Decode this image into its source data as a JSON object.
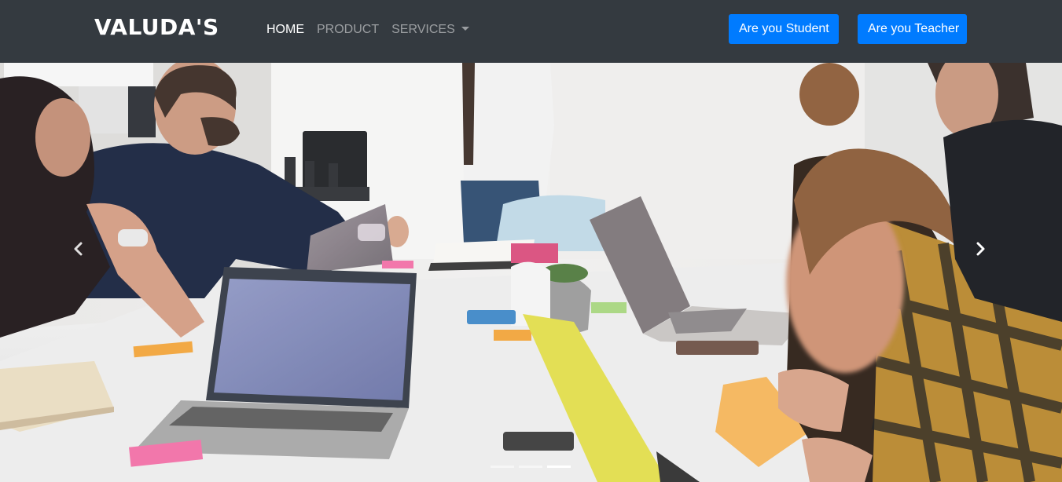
{
  "navbar": {
    "brand": "VALUDA'S",
    "links": [
      {
        "label": "HOME",
        "active": true
      },
      {
        "label": "PRODUCT",
        "active": false
      },
      {
        "label": "SERVICES",
        "active": false,
        "dropdown": true
      }
    ],
    "buttons": {
      "student": "Are you Student",
      "teacher": "Are you Teacher"
    },
    "colors": {
      "background": "#343a40",
      "button": "#007bff"
    }
  },
  "carousel": {
    "slide_count": 3,
    "active_slide": 3,
    "prev_icon": "chevron-left-icon",
    "next_icon": "chevron-right-icon"
  }
}
